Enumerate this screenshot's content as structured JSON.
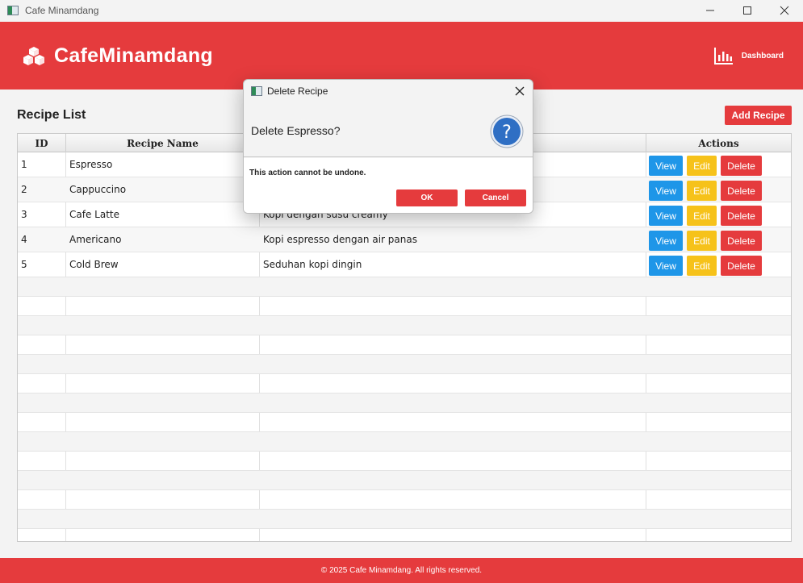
{
  "window": {
    "title": "Cafe Minamdang",
    "controls": {
      "minimize": "minimize-icon",
      "maximize": "maximize-icon",
      "close": "close-icon"
    }
  },
  "header": {
    "brand": "CafeMinamdang",
    "brand_icon": "cubes-icon",
    "dashboard_label": "Dashboard",
    "dashboard_icon": "bar-chart-icon",
    "color": "#e53b3d"
  },
  "content": {
    "title": "Recipe List",
    "add_button": "Add Recipe",
    "table": {
      "columns": [
        "ID",
        "Recipe Name",
        "",
        "Actions"
      ],
      "rows": [
        {
          "id": "1",
          "name": "Espresso",
          "description": "",
          "actions": [
            "View",
            "Edit",
            "Delete"
          ]
        },
        {
          "id": "2",
          "name": "Cappuccino",
          "description": "",
          "actions": [
            "View",
            "Edit",
            "Delete"
          ]
        },
        {
          "id": "3",
          "name": "Cafe Latte",
          "description": "Kopi dengan susu creamy",
          "actions": [
            "View",
            "Edit",
            "Delete"
          ]
        },
        {
          "id": "4",
          "name": "Americano",
          "description": "Kopi espresso dengan air panas",
          "actions": [
            "View",
            "Edit",
            "Delete"
          ]
        },
        {
          "id": "5",
          "name": "Cold Brew",
          "description": "Seduhan kopi dingin",
          "actions": [
            "View",
            "Edit",
            "Delete"
          ]
        }
      ]
    },
    "colors": {
      "view": "#1e96e8",
      "edit": "#f6c21a",
      "delete": "#e53b3d"
    }
  },
  "dialog": {
    "title": "Delete Recipe",
    "question": "Delete Espresso?",
    "icon": "question-icon",
    "note": "This action cannot be undone.",
    "ok": "OK",
    "cancel": "Cancel"
  },
  "footer": {
    "text": "© 2025 Cafe Minamdang. All rights reserved."
  }
}
